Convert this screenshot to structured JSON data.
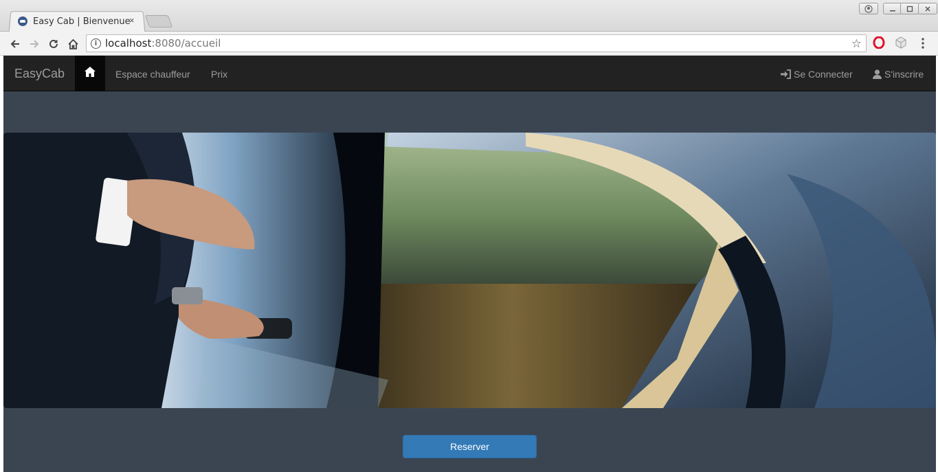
{
  "browser": {
    "tab_title": "Easy Cab | Bienvenue",
    "tab_close": "×",
    "url_host": "localhost",
    "url_rest": ":8080/accueil",
    "info_glyph": "i"
  },
  "navbar": {
    "brand": "EasyCab",
    "home_icon": "home-icon",
    "links": [
      "Espace chauffeur",
      "Prix"
    ],
    "login_label": "Se Connecter",
    "signup_label": "S'inscrire"
  },
  "hero": {
    "description_icon": "chauffeur-opening-car-door-photo"
  },
  "actions": {
    "reserve_label": "Reserver"
  },
  "colors": {
    "page_bg": "#3b4552",
    "navbar_bg": "#222222",
    "navbar_active": "#080808",
    "navbar_text": "#9d9d9d",
    "primary_button": "#337ab7"
  }
}
